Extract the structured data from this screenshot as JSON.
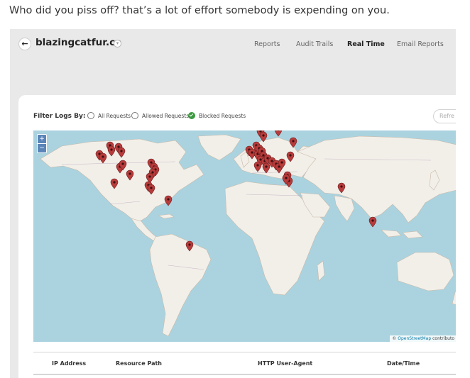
{
  "comment": "Who did you piss off? that’s a lot of effort somebody is expending on you.",
  "header": {
    "back_icon": "arrow-left-icon",
    "site_name": "blazingcatfur.ca",
    "site_dropdown_icon": "chevron-down-icon",
    "nav": [
      {
        "label": "Reports",
        "active": false
      },
      {
        "label": "Audit Trails",
        "active": false
      },
      {
        "label": "Real Time",
        "active": true
      },
      {
        "label": "Email Reports",
        "active": false
      }
    ]
  },
  "filter": {
    "label": "Filter Logs By:",
    "options": [
      {
        "label": "All Requests",
        "checked": false
      },
      {
        "label": "Allowed Requests",
        "checked": false
      },
      {
        "label": "Blocked Requests",
        "checked": true
      }
    ],
    "refresh_label": "Refre"
  },
  "map": {
    "zoom_in": "+",
    "zoom_out": "−",
    "attribution_symbol": "©",
    "attribution_link": "OpenStreetMap",
    "attribution_rest": "contributo",
    "marker_color": "#b83b3b",
    "marker_count": 52
  },
  "table": {
    "headers": [
      "IP Address",
      "Resource Path",
      "HTTP User-Agent",
      "Date/Time"
    ]
  }
}
